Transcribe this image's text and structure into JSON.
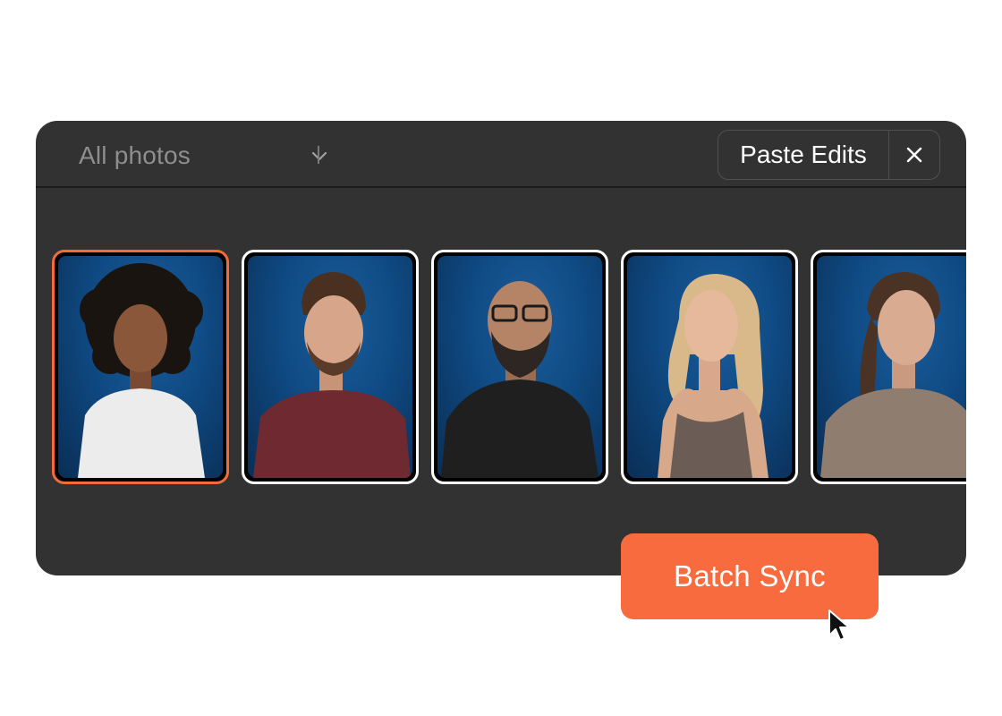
{
  "toolbar": {
    "filter_label": "All photos",
    "paste_label": "Paste Edits"
  },
  "photos": [
    {
      "name": "portrait-1",
      "selected": true
    },
    {
      "name": "portrait-2",
      "selected": false
    },
    {
      "name": "portrait-3",
      "selected": false
    },
    {
      "name": "portrait-4",
      "selected": false
    },
    {
      "name": "portrait-5",
      "selected": false
    }
  ],
  "action": {
    "batch_label": "Batch Sync"
  },
  "colors": {
    "accent": "#f76b3e",
    "selected_border": "#f36b3b",
    "panel_bg": "#323232",
    "photo_bg": "#0f4a83"
  },
  "icons": {
    "dropdown": "chevron-down-icon",
    "close": "close-icon",
    "pointer": "mouse-pointer-icon"
  }
}
